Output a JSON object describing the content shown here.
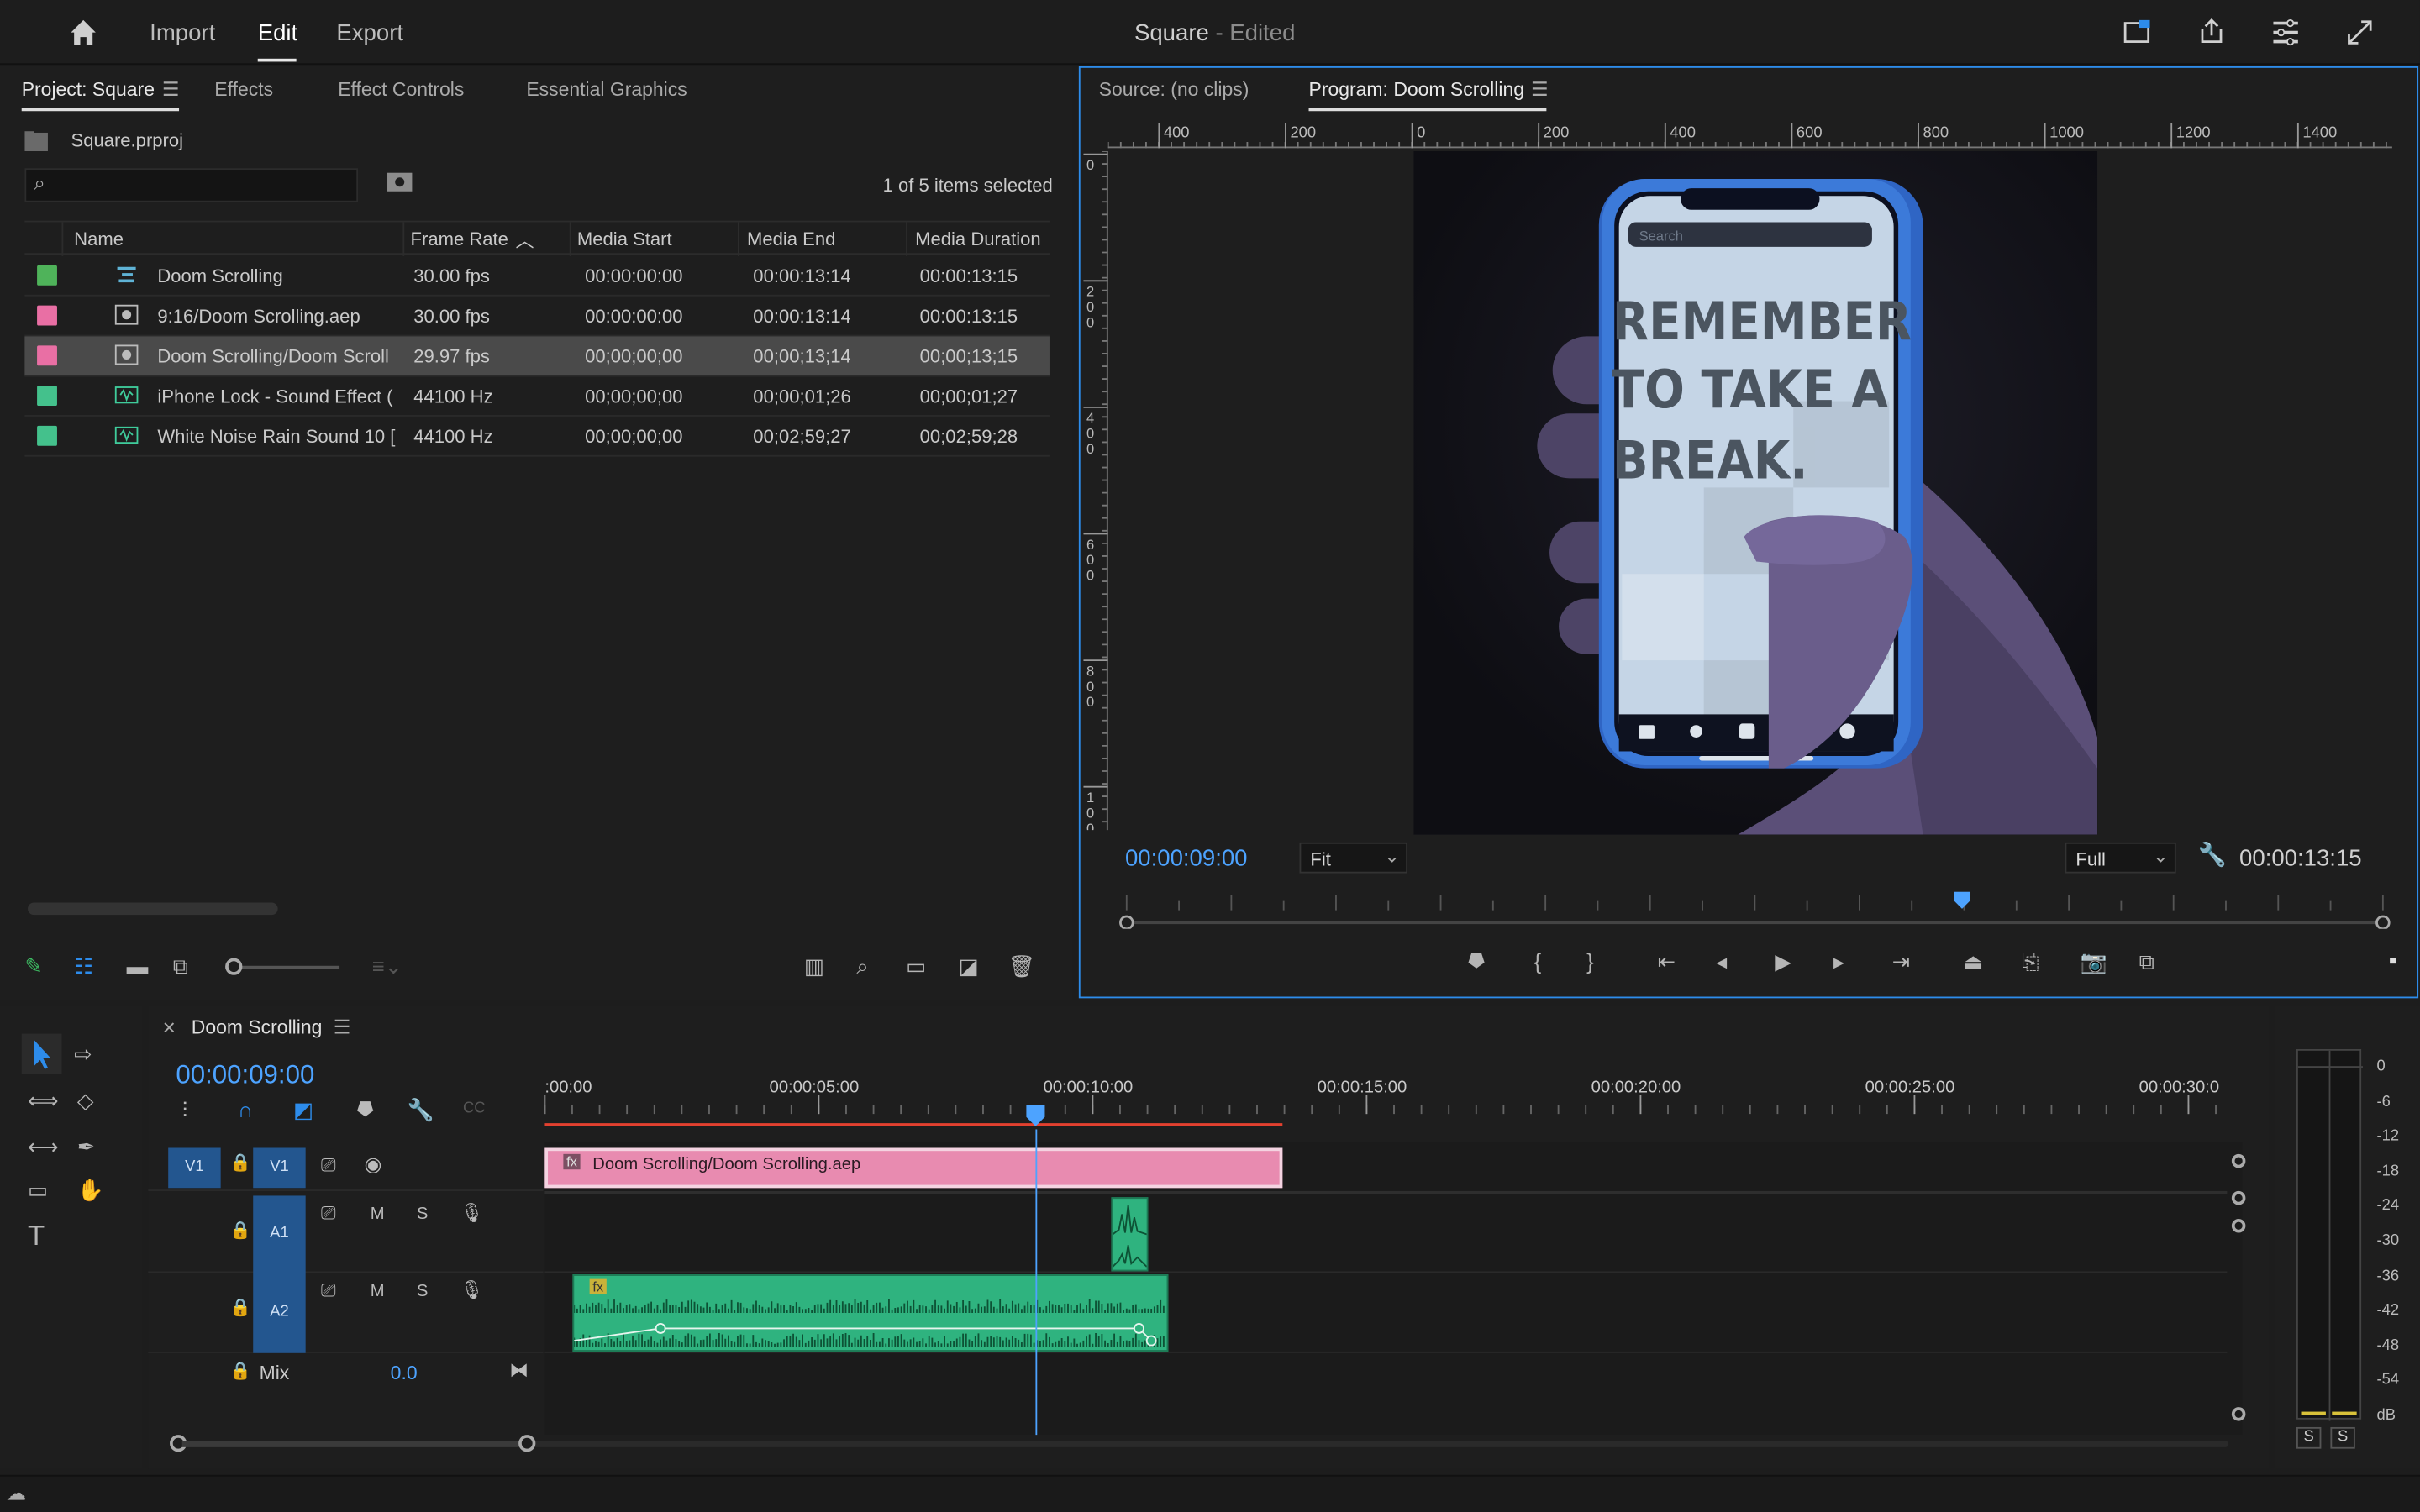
{
  "topbar": {
    "home_icon": "home-icon",
    "nav": [
      "Import",
      "Edit",
      "Export"
    ],
    "active_nav": "Edit",
    "doc_title": "Square",
    "doc_status": " - Edited"
  },
  "project_panel": {
    "tabs": [
      "Project: Square",
      "Effects",
      "Effect Controls",
      "Essential Graphics"
    ],
    "active_tab": "Project: Square",
    "project_file": "Square.prproj",
    "search_placeholder": "",
    "selection_status": "1 of 5 items selected",
    "columns": [
      "Name",
      "Frame Rate",
      "Media Start",
      "Media End",
      "Media Duration"
    ],
    "rows": [
      {
        "color": "#4fb35a",
        "icon": "sequence-icon",
        "name": "Doom Scrolling",
        "rate": "30.00 fps",
        "start": "00:00:00:00",
        "end": "00:00:13:14",
        "duration": "00:00:13:15"
      },
      {
        "color": "#e96fa4",
        "icon": "aep-file-icon",
        "name": "9:16/Doom Scrolling.aep",
        "rate": "30.00 fps",
        "start": "00:00:00:00",
        "end": "00:00:13:14",
        "duration": "00:00:13:15"
      },
      {
        "color": "#e96fa4",
        "icon": "aep-file-icon",
        "name": "Doom Scrolling/Doom Scroll",
        "rate": "29.97 fps",
        "start": "00;00;00;00",
        "end": "00;00;13;14",
        "duration": "00;00;13;15",
        "selected": true
      },
      {
        "color": "#44c18c",
        "icon": "audio-file-icon",
        "name": "iPhone Lock - Sound Effect (",
        "rate": "44100 Hz",
        "start": "00;00;00;00",
        "end": "00;00;01;26",
        "duration": "00;00;01;27"
      },
      {
        "color": "#44c18c",
        "icon": "audio-file-icon",
        "name": "White Noise Rain Sound 10 [",
        "rate": "44100 Hz",
        "start": "00;00;00;00",
        "end": "00;02;59;27",
        "duration": "00;02;59;28"
      }
    ]
  },
  "monitor": {
    "tabs": [
      "Source: (no clips)",
      "Program: Doom Scrolling"
    ],
    "active_tab": "Program: Doom Scrolling",
    "ruler_h": [
      "400",
      "200",
      "0",
      "200",
      "400",
      "600",
      "800",
      "1000",
      "1200",
      "1400"
    ],
    "ruler_v": [
      "0",
      "200",
      "400",
      "600",
      "800",
      "100"
    ],
    "current_time": "00:00:09:00",
    "zoom": "Fit",
    "resolution": "Full",
    "duration": "00:00:13:15",
    "playhead_fraction": 0.665,
    "phone": {
      "search": "Search",
      "headline": [
        "REMEMBER",
        "TO TAKE A",
        "BREAK."
      ]
    }
  },
  "timeline": {
    "tab": "Doom Scrolling",
    "current_time": "00:00:09:00",
    "ruler": [
      ":00:00",
      "00:00:05:00",
      "00:00:10:00",
      "00:00:15:00",
      "00:00:20:00",
      "00:00:25:00",
      "00:00:30:0"
    ],
    "tracks": {
      "v1_src": "V1",
      "v1": "V1",
      "a1": "A1",
      "a2": "A2",
      "mute": "M",
      "solo": "S",
      "mix_label": "Mix",
      "mix_value": "0.0"
    },
    "video_clip": "Doom Scrolling/Doom Scrolling.aep",
    "fx_badge": "fx",
    "meter_scale": [
      "0",
      "-6",
      "-12",
      "-18",
      "-24",
      "-30",
      "-36",
      "-42",
      "-48",
      "-54",
      "dB"
    ],
    "meter_solo": [
      "S",
      "S"
    ]
  },
  "colors": {
    "accent": "#2d8ceb",
    "timecode": "#4da3ff",
    "video_clip": "#e88bb0",
    "audio_clip": "#2fb37f",
    "selected_row": "#4a4a4a"
  }
}
